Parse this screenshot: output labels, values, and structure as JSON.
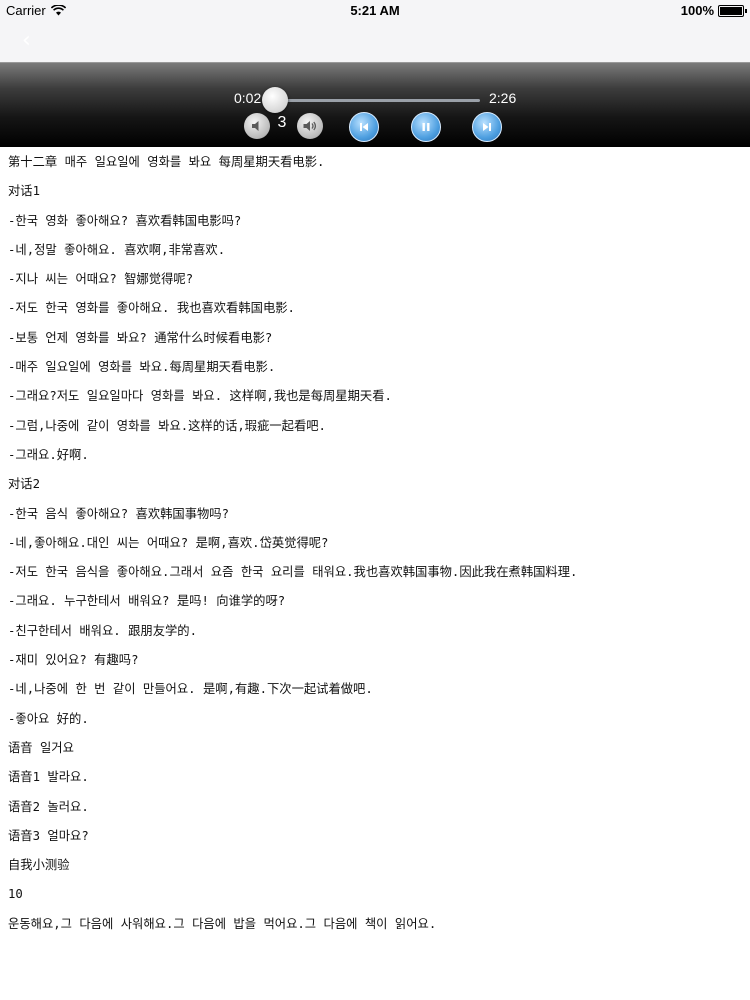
{
  "status_bar": {
    "carrier": "Carrier",
    "time": "5:21 AM",
    "battery": "100%",
    "battery_level": 1.0
  },
  "nav": {
    "back_label": "‹"
  },
  "player": {
    "elapsed": "0:02",
    "duration": "2:26",
    "progress": 0.014,
    "volume_level": "3"
  },
  "lines": [
    "第十二章 매주 일요일에 영화를 봐요 每周星期天看电影.",
    "对话1",
    "-한국 영화 좋아해요? 喜欢看韩国电影吗?",
    "-네,정말 좋아해요. 喜欢啊,非常喜欢.",
    "-지나 씨는 어때요? 智娜觉得呢?",
    "-저도 한국 영화를 좋아해요. 我也喜欢看韩国电影.",
    "-보통 언제 영화를 봐요? 通常什么时候看电影?",
    "-매주 일요일에 영화를 봐요.每周星期天看电影.",
    "-그래요?저도 일요일마다 영화를 봐요. 这样啊,我也是每周星期天看.",
    "-그럼,나중에 같이 영화를 봐요.这样的话,瑕疵一起看吧.",
    "-그래요.好啊.",
    "对话2",
    "-한국 음식 좋아해요? 喜欢韩国事物吗?",
    "-네,좋아해요.대인 씨는 어때요? 是啊,喜欢.岱英觉得呢?",
    "-저도 한국 음식을 좋아해요.그래서 요즘 한국 요리를 태워요.我也喜欢韩国事物.因此我在煮韩国料理.",
    "-그래요. 누구한테서 배워요? 是吗! 向谁学的呀?",
    "-친구한테서 배워요. 跟朋友学的.",
    "-재미 있어요? 有趣吗?",
    "-네,나중에 한 번 같이 만들어요. 是啊,有趣.下次一起试着做吧.",
    "-좋아요 好的.",
    "语音 일거요",
    "语音1 발라요.",
    "语音2 놀러요.",
    "语音3 얼마요?",
    "自我小测验",
    "10",
    "운동해요,그 다음에 사워해요.그 다음에 밥을 먹어요.그 다음에 책이 읽어요."
  ]
}
